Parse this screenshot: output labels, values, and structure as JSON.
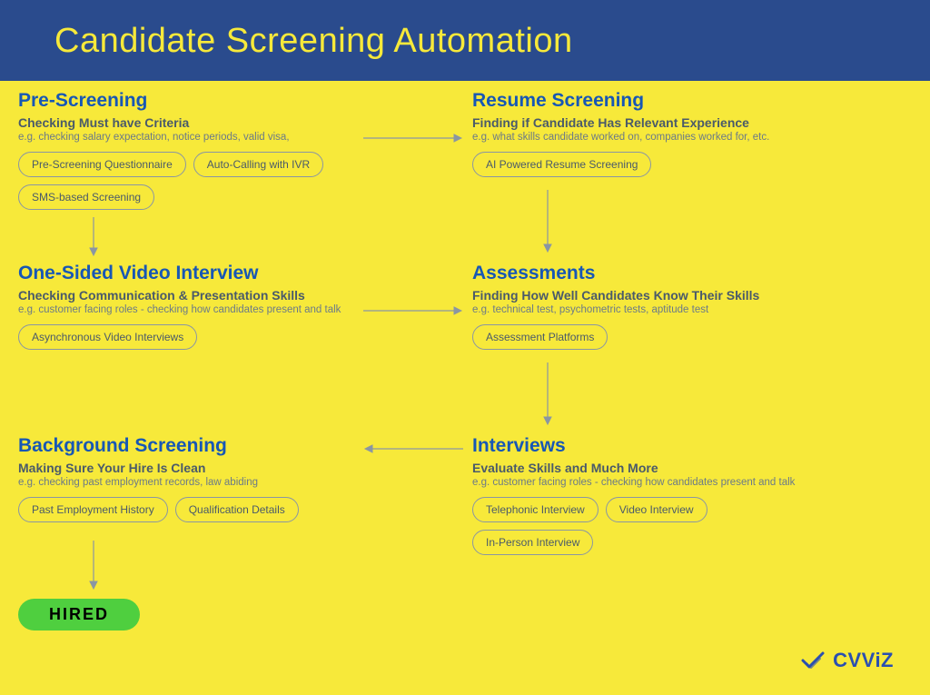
{
  "header": {
    "title": "Candidate Screening Automation"
  },
  "nodes": {
    "pre": {
      "title": "Pre-Screening",
      "subtitle": "Checking Must have Criteria",
      "example": "e.g. checking salary expectation, notice periods, valid visa,",
      "pills": [
        "Pre-Screening Questionnaire",
        "Auto-Calling with IVR",
        "SMS-based Screening"
      ]
    },
    "resume": {
      "title": "Resume Screening",
      "subtitle": "Finding if Candidate Has Relevant Experience",
      "example": "e.g. what skills candidate worked on, companies worked for, etc.",
      "pills": [
        "AI Powered Resume Screening"
      ]
    },
    "video": {
      "title": "One-Sided Video Interview",
      "subtitle": "Checking Communication & Presentation Skills",
      "example": "e.g. customer facing roles - checking how candidates present and talk",
      "pills": [
        "Asynchronous Video Interviews"
      ]
    },
    "assess": {
      "title": "Assessments",
      "subtitle": "Finding How Well Candidates Know Their Skills",
      "example": "e.g. technical test, psychometric tests, aptitude test",
      "pills": [
        "Assessment Platforms"
      ]
    },
    "bg": {
      "title": "Background Screening",
      "subtitle": "Making Sure Your Hire Is Clean",
      "example": "e.g. checking past employment records, law abiding",
      "pills": [
        "Past Employment History",
        "Qualification Details"
      ]
    },
    "interviews": {
      "title": "Interviews",
      "subtitle": "Evaluate Skills and Much More",
      "example": "e.g. customer facing roles - checking how candidates present and talk",
      "pills": [
        "Telephonic Interview",
        "Video Interview",
        "In-Person Interview"
      ]
    }
  },
  "hired": {
    "label": "HIRED"
  },
  "logo": {
    "text": "CVViZ"
  }
}
